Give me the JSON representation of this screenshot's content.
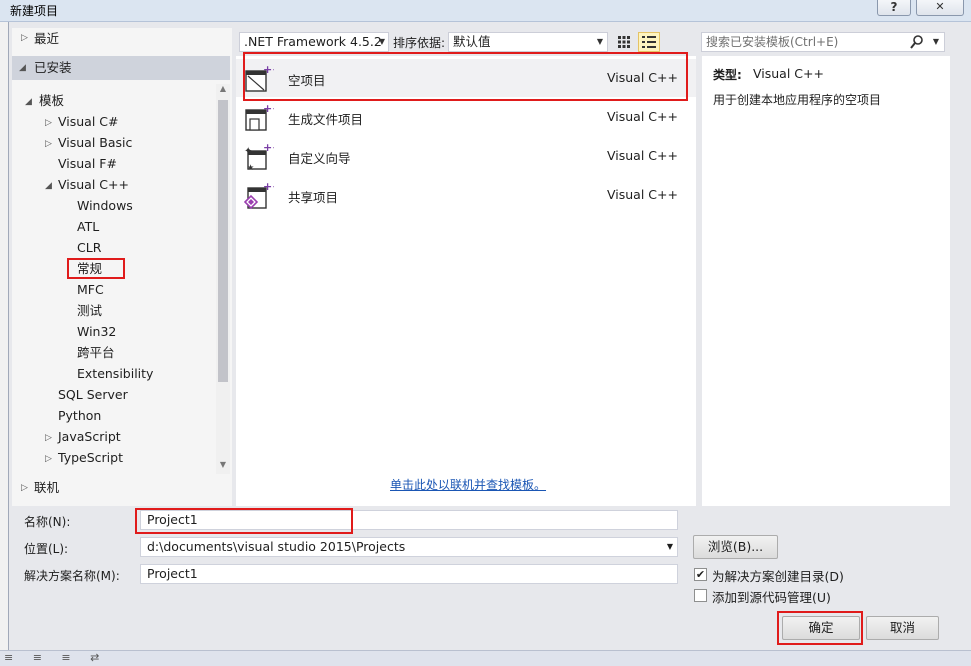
{
  "window": {
    "title": "新建项目",
    "help_label": "?",
    "close_label": "✕"
  },
  "tree": {
    "recent": "最近",
    "installed": "已安装",
    "templates": "模板",
    "items": [
      {
        "label": "Visual C#",
        "level": 2,
        "arrow": "▷"
      },
      {
        "label": "Visual Basic",
        "level": 2,
        "arrow": "▷"
      },
      {
        "label": "Visual F#",
        "level": 2,
        "arrow": ""
      },
      {
        "label": "Visual C++",
        "level": 2,
        "arrow": "◢"
      },
      {
        "label": "Windows",
        "level": 3,
        "arrow": ""
      },
      {
        "label": "ATL",
        "level": 3,
        "arrow": ""
      },
      {
        "label": "CLR",
        "level": 3,
        "arrow": ""
      },
      {
        "label": "常规",
        "level": 3,
        "arrow": ""
      },
      {
        "label": "MFC",
        "level": 3,
        "arrow": ""
      },
      {
        "label": "测试",
        "level": 3,
        "arrow": ""
      },
      {
        "label": "Win32",
        "level": 3,
        "arrow": ""
      },
      {
        "label": "跨平台",
        "level": 3,
        "arrow": ""
      },
      {
        "label": "Extensibility",
        "level": 3,
        "arrow": ""
      },
      {
        "label": "SQL Server",
        "level": 2,
        "arrow": ""
      },
      {
        "label": "Python",
        "level": 2,
        "arrow": ""
      },
      {
        "label": "JavaScript",
        "level": 2,
        "arrow": "▷"
      },
      {
        "label": "TypeScript",
        "level": 2,
        "arrow": "▷"
      }
    ],
    "online": "联机"
  },
  "toolbar": {
    "framework": ".NET Framework 4.5.2",
    "sort_label": "排序依据:",
    "sort_value": "默认值",
    "search_placeholder": "搜索已安装模板(Ctrl+E)"
  },
  "templates": [
    {
      "name": "空项目",
      "lang": "Visual C++"
    },
    {
      "name": "生成文件项目",
      "lang": "Visual C++"
    },
    {
      "name": "自定义向导",
      "lang": "Visual C++"
    },
    {
      "name": "共享项目",
      "lang": "Visual C++"
    }
  ],
  "online_link": "单击此处以联机并查找模板。",
  "description": {
    "type_label": "类型:",
    "type_value": "Visual C++",
    "text": "用于创建本地应用程序的空项目"
  },
  "form": {
    "name_label": "名称(N):",
    "name_value": "Project1",
    "location_label": "位置(L):",
    "location_value": "d:\\documents\\visual studio 2015\\Projects",
    "solution_label": "解决方案名称(M):",
    "solution_value": "Project1",
    "browse_label": "浏览(B)...",
    "create_dir_label": "为解决方案创建目录(D)",
    "create_dir_checked": true,
    "source_control_label": "添加到源代码管理(U)",
    "source_control_checked": false,
    "ok_label": "确定",
    "cancel_label": "取消"
  },
  "colors": {
    "highlight": "#e01b1b",
    "selected_row": "#cfd3dc",
    "link": "#1a56b4"
  }
}
